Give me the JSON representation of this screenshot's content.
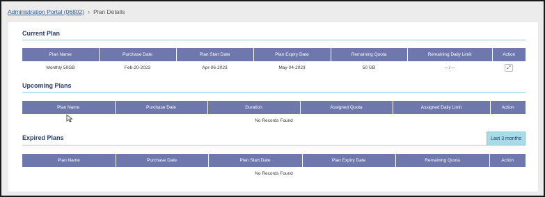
{
  "breadcrumb": {
    "root": "Administration Portal (06802)",
    "separator": "›",
    "current": "Plan Details"
  },
  "current_plan": {
    "title": "Current Plan",
    "columns": [
      "Plan Name",
      "Purchase Date",
      "Plan Start Date",
      "Plan Expiry Date",
      "Remaining Quota",
      "Remaining Daily Limit",
      "Action"
    ],
    "rows": [
      [
        "Monthly 50GB",
        "Feb-20-2023",
        "Apr-06-2023",
        "May-04-2023",
        "50 GB",
        "-- / --"
      ]
    ],
    "action_icon": "expand-icon"
  },
  "upcoming_plans": {
    "title": "Upcoming Plans",
    "columns": [
      "Plan Name",
      "Purchase Date",
      "Duration",
      "Assigned Quota",
      "Assigned Daily Limit",
      "Action"
    ],
    "empty_text": "No Records Found"
  },
  "expired_plans": {
    "title": "Expired Plans",
    "filter_label": "Last 3 months",
    "columns": [
      "Plan Name",
      "Purchase Date",
      "Plan Start Date",
      "Plan Expiry Date",
      "Remaining Quota",
      "Action"
    ],
    "empty_text": "No Records Found"
  },
  "colors": {
    "header_bg": "#6e78ad",
    "rule": "#8fd3de",
    "filter_bg": "#a7dbe8",
    "title": "#2a3d6e"
  }
}
